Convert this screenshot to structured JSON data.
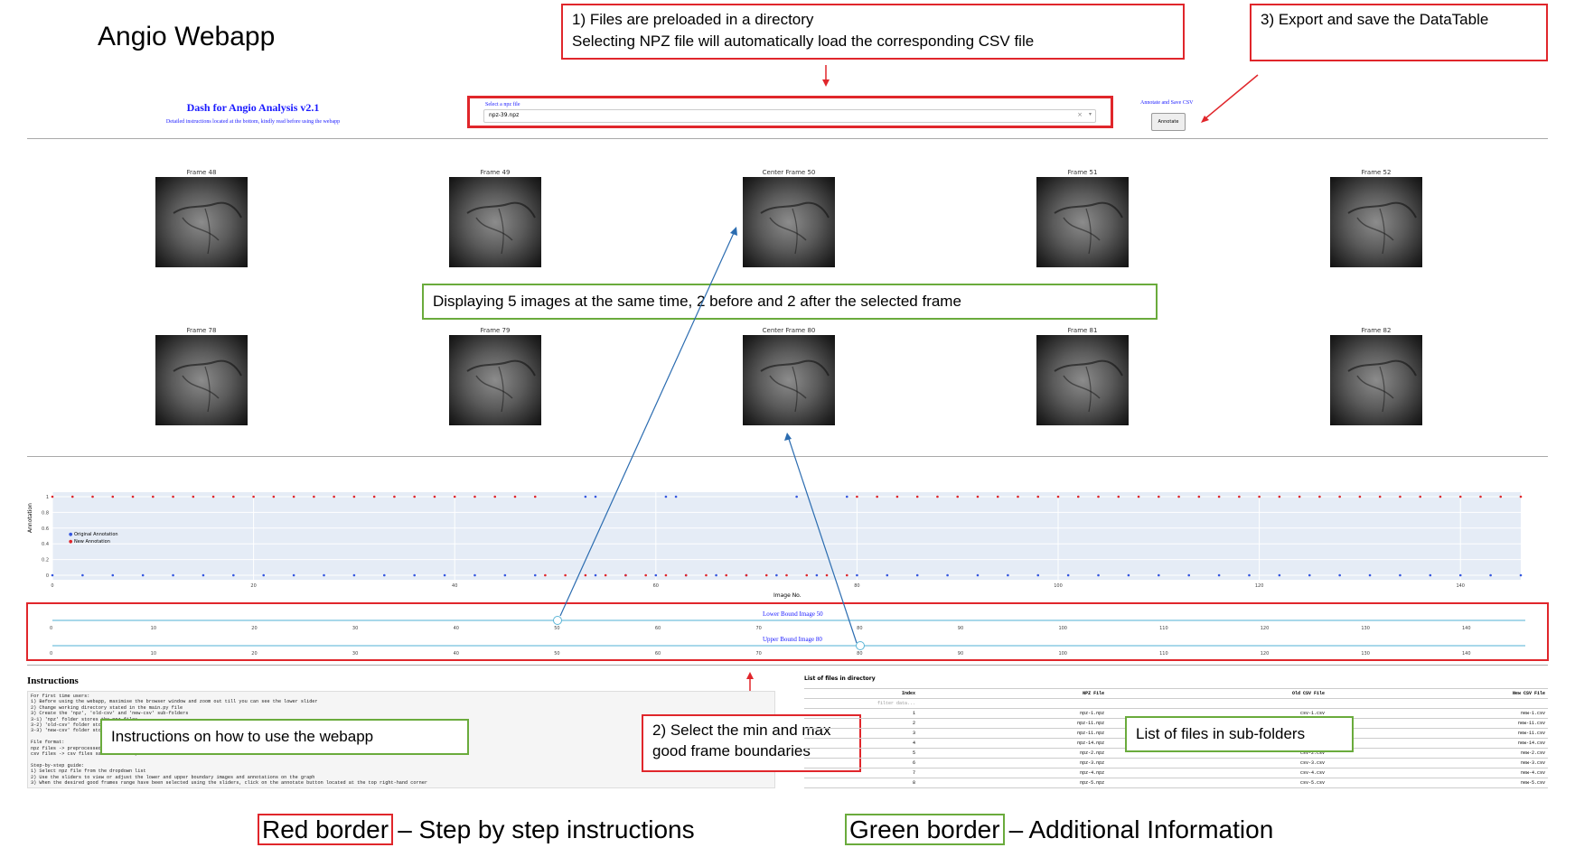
{
  "app_title": "Angio Webapp",
  "dash": {
    "title": "Dash for Angio Analysis v2.1",
    "subtitle": "Detailed instructions located at the bottom, kindly read before using the webapp",
    "select_label": "Select a npz file",
    "select_value": "npz-39.npz",
    "annotate_label": "Annotate and Save CSV",
    "annotate_button": "Annotate"
  },
  "callouts": {
    "step1_line1": "1) Files are preloaded in a directory",
    "step1_line2": "Selecting NPZ file will automatically load the corresponding CSV file",
    "step3": "3) Export and save the DataTable",
    "display5": "Displaying 5 images at the same time, 2 before and 2 after the selected frame",
    "instructions_note": "Instructions on how to use the webapp",
    "step2_line1": "2) Select the min and max",
    "step2_line2": "good frame boundaries",
    "files_note": "List of files in sub-folders"
  },
  "frames_row1": [
    "Frame 48",
    "Frame 49",
    "Center Frame 50",
    "Frame 51",
    "Frame 52"
  ],
  "frames_row2": [
    "Frame 78",
    "Frame 79",
    "Center Frame 80",
    "Frame 81",
    "Frame 82"
  ],
  "chart_data": {
    "type": "scatter",
    "ylabel": "Annotation",
    "xlabel": "Image No.",
    "xlim": [
      0,
      146
    ],
    "ylim": [
      0,
      1
    ],
    "y_ticks": [
      "0",
      "0.2",
      "0.4",
      "0.6",
      "0.8",
      "1"
    ],
    "x_ticks": [
      "0",
      "20",
      "40",
      "60",
      "80",
      "100",
      "120",
      "140"
    ],
    "legend": [
      "Original Annotation",
      "New Annotation"
    ],
    "legend_position": "left",
    "series": [
      {
        "name": "Original Annotation",
        "color": "#3557e0",
        "ones": [
          53,
          54,
          61,
          62,
          74,
          79
        ],
        "zeros_ranges": [
          [
            0,
            48
          ],
          [
            54,
            60
          ],
          [
            63,
            73
          ],
          [
            76,
            78
          ],
          [
            80,
            146
          ]
        ]
      },
      {
        "name": "New Annotation",
        "color": "#e0262b",
        "ones_ranges": [
          [
            0,
            48
          ],
          [
            80,
            146
          ]
        ],
        "zeros_ranges": [
          [
            49,
            79
          ]
        ]
      }
    ]
  },
  "sliders": {
    "lower_label": "Lower Bound Image 50",
    "upper_label": "Upper Bound Image 80",
    "lower_value": 50,
    "upper_value": 80,
    "ticks": [
      "0",
      "10",
      "20",
      "30",
      "40",
      "50",
      "60",
      "70",
      "80",
      "90",
      "100",
      "110",
      "120",
      "130",
      "140"
    ]
  },
  "instructions": {
    "title": "Instructions",
    "text": "For first time users:\n1) Before using the webapp, maximise the browser window and zoom out till you can see the lower slider\n2) Change working directory stated in the main.py file\n3) Create the 'npz', 'old-csv' and 'new-csv' sub-folders\n3-1) 'npz' folder stores the npz files\n3-2) 'old-csv' folder stores the original annotation csv files\n3-3) 'new-csv' folder stores the new annotation csv files\n\nFile format:\nnpz files -> preprocessed angiography images stored in numpy arrays\ncsv files -> csv files saved as frame, annotation format\n\nStep-by-step guide:\n1) Select npz file from the dropdown list\n2) Use the sliders to view or adjust the lower and upper boundary images and annotations on the graph\n3) When the desired good frames range have been selected using the sliders, click on the annotate button located at the top right-hand corner"
  },
  "files_table": {
    "title": "List of files in directory",
    "headers": [
      "Index",
      "NPZ File",
      "Old CSV File",
      "New CSV File"
    ],
    "filter_placeholder": "filter data...",
    "rows": [
      [
        "1",
        "npz-1.npz",
        "csv-1.csv",
        "new-1.csv"
      ],
      [
        "2",
        "npz-11.npz",
        "csv-11.csv",
        "new-11.csv"
      ],
      [
        "3",
        "npz-11.npz",
        "csv-11.csv",
        "new-11.csv"
      ],
      [
        "4",
        "npz-14.npz",
        "csv-14.csv",
        "new-14.csv"
      ],
      [
        "5",
        "npz-2.npz",
        "csv-2.csv",
        "new-2.csv"
      ],
      [
        "6",
        "npz-3.npz",
        "csv-3.csv",
        "new-3.csv"
      ],
      [
        "7",
        "npz-4.npz",
        "csv-4.csv",
        "new-4.csv"
      ],
      [
        "8",
        "npz-5.npz",
        "csv-5.csv",
        "new-5.csv"
      ]
    ]
  },
  "legend": {
    "red_label": "Red border",
    "red_desc": "– Step by step instructions",
    "green_label": "Green border",
    "green_desc": "– Additional Information"
  },
  "colors": {
    "red": "#e0262b",
    "green": "#6aab3c",
    "blue_arrow": "#2b6cb0",
    "dash_blue": "#1a1aff"
  }
}
